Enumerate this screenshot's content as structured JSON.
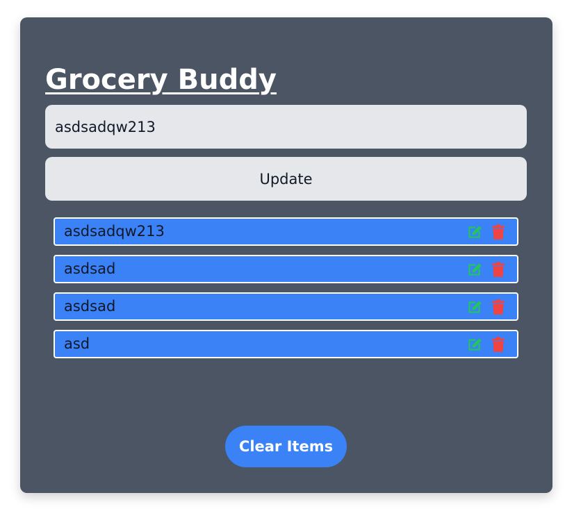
{
  "app": {
    "title": "Grocery Buddy"
  },
  "form": {
    "input_value": "asdsadqw213",
    "input_placeholder": "",
    "submit_label": "Update"
  },
  "items": [
    {
      "label": "asdsadqw213",
      "edit_icon": "edit-icon",
      "delete_icon": "trash-icon"
    },
    {
      "label": "asdsad",
      "edit_icon": "edit-icon",
      "delete_icon": "trash-icon"
    },
    {
      "label": "asdsad",
      "edit_icon": "edit-icon",
      "delete_icon": "trash-icon"
    },
    {
      "label": "asd",
      "edit_icon": "edit-icon",
      "delete_icon": "trash-icon"
    }
  ],
  "footer": {
    "clear_label": "Clear Items"
  },
  "colors": {
    "card_bg": "#4b5563",
    "item_bg": "#3b82f6",
    "edit_icon": "#22c55e",
    "delete_icon": "#ef4444",
    "field_bg": "#e5e7eb"
  }
}
